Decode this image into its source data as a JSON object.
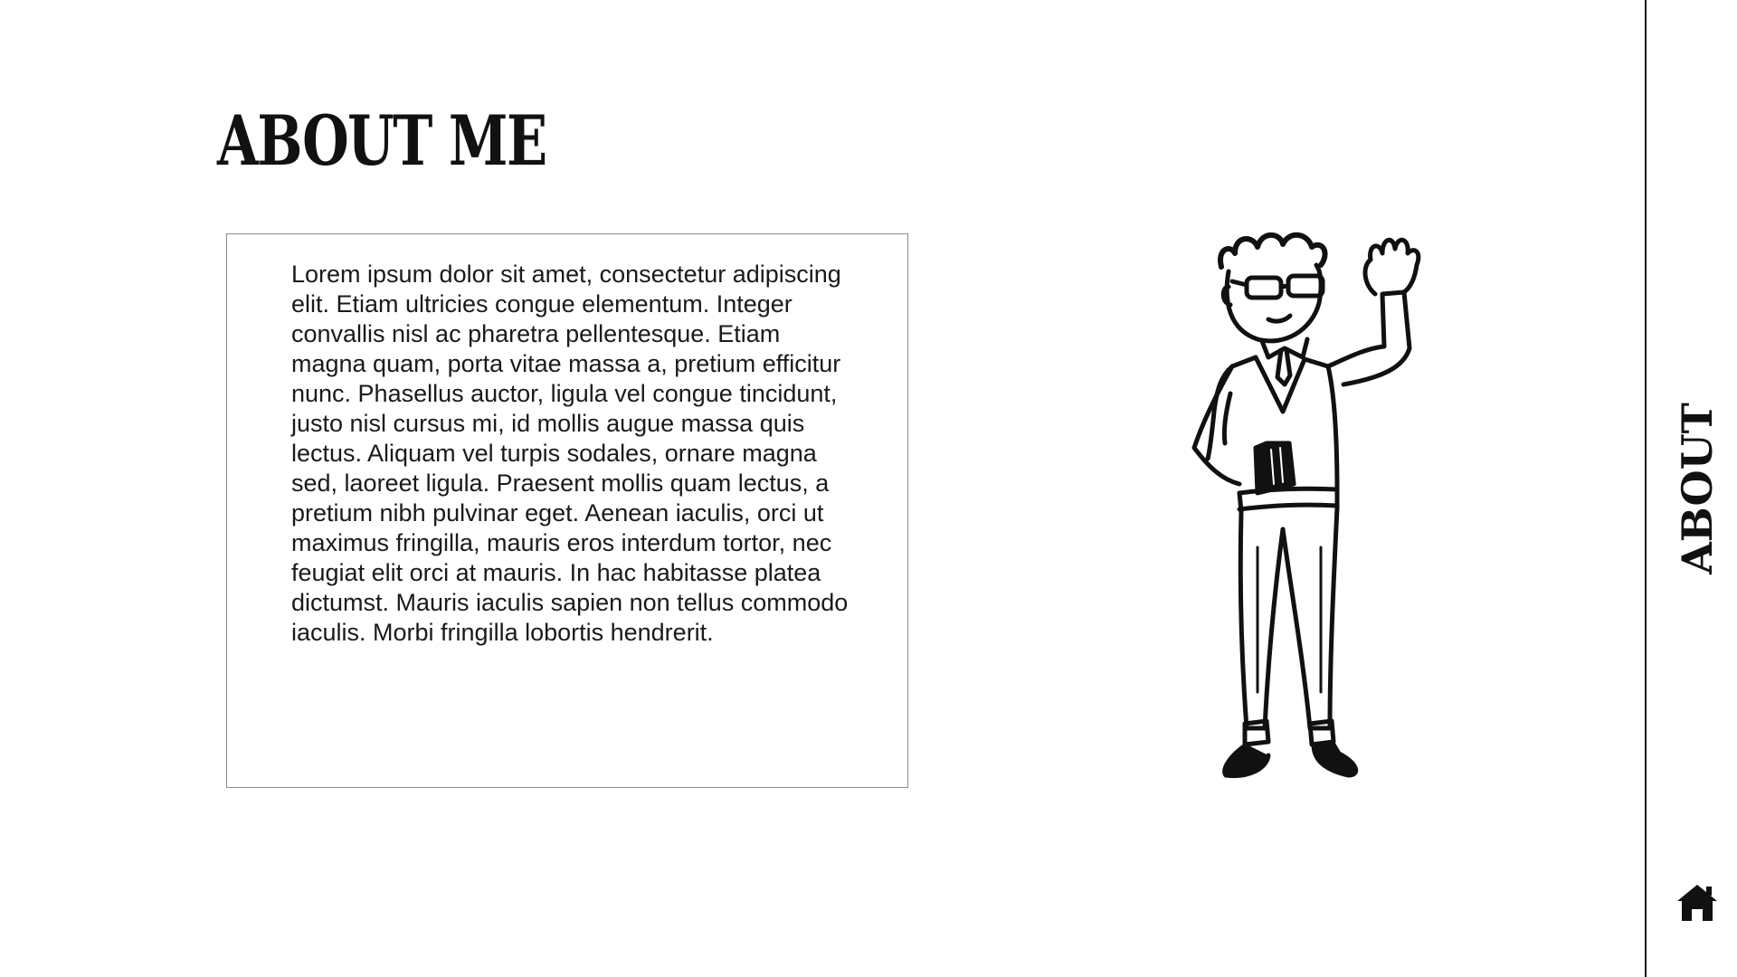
{
  "page": {
    "title": "ABOUT ME",
    "body": "Lorem ipsum dolor sit amet, consectetur adipiscing elit. Etiam ultricies congue elementum. Integer convallis nisl ac pharetra pellentesque. Etiam magna quam, porta vitae massa a, pretium efficitur nunc. Phasellus auctor, ligula vel congue tincidunt, justo nisl cursus mi, id mollis augue massa quis lectus. Aliquam vel turpis sodales, ornare magna sed, laoreet ligula. Praesent mollis quam lectus, a pretium nibh pulvinar eget. Aenean iaculis, orci ut maximus fringilla, mauris eros interdum tortor, nec feugiat elit orci at mauris. In hac habitasse platea dictumst. Mauris iaculis sapien non tellus commodo iaculis. Morbi fringilla lobortis hendrerit."
  },
  "sidebar": {
    "label": "ABOUT",
    "home_icon": "home-icon"
  },
  "illustration": {
    "subject": "waving-man-illustration"
  },
  "colors": {
    "text": "#111111",
    "background": "#ffffff",
    "border": "#8a8a8a"
  }
}
